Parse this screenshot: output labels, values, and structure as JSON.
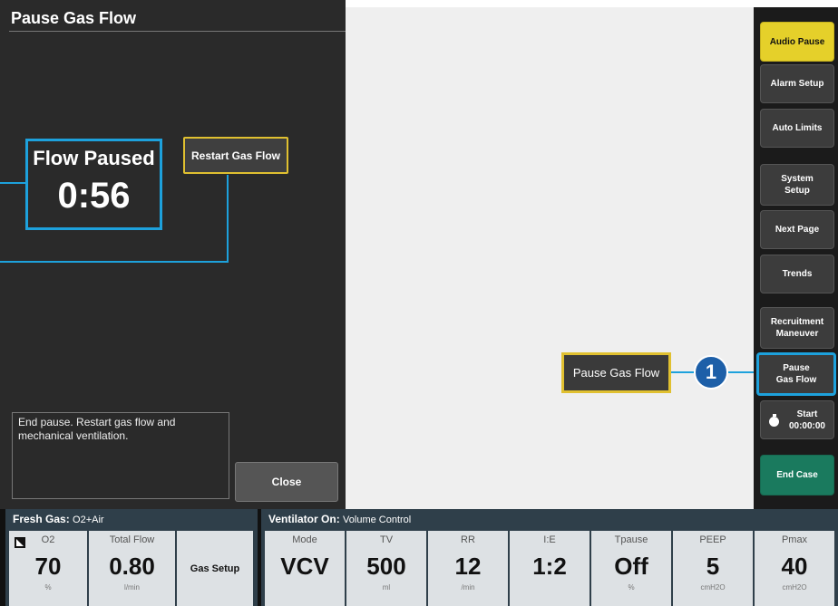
{
  "dialog": {
    "title": "Pause Gas Flow",
    "timer_label": "Flow Paused",
    "timer_value": "0:56",
    "restart_label": "Restart Gas Flow",
    "help_text": "End pause. Restart gas flow and mechanical ventilation.",
    "close_label": "Close"
  },
  "callout": {
    "tooltip": "Pause Gas Flow",
    "marker": "1"
  },
  "sidebar": {
    "audio_pause": "Audio Pause",
    "alarm_setup": "Alarm Setup",
    "auto_limits": "Auto Limits",
    "system_setup": "System Setup",
    "next_page": "Next Page",
    "trends": "Trends",
    "recruitment": "Recruitment Maneuver",
    "pause_gas_flow": "Pause Gas Flow",
    "timer_start": "Start",
    "timer_time": "00:00:00",
    "end_case": "End Case"
  },
  "fresh_gas": {
    "title": "Fresh Gas",
    "mix": "O2+Air",
    "o2": {
      "label": "O2",
      "value": "70",
      "unit": "%"
    },
    "total_flow": {
      "label": "Total Flow",
      "value": "0.80",
      "unit": "l/min"
    },
    "gas_setup": "Gas Setup"
  },
  "ventilator": {
    "title": "Ventilator On",
    "mode_name": "Volume Control",
    "params": [
      {
        "label": "Mode",
        "value": "VCV",
        "unit": ""
      },
      {
        "label": "TV",
        "value": "500",
        "unit": "ml"
      },
      {
        "label": "RR",
        "value": "12",
        "unit": "/min"
      },
      {
        "label": "I:E",
        "value": "1:2",
        "unit": ""
      },
      {
        "label": "Tpause",
        "value": "Off",
        "unit": "%"
      },
      {
        "label": "PEEP",
        "value": "5",
        "unit": "cmH2O"
      },
      {
        "label": "Pmax",
        "value": "40",
        "unit": "cmH2O"
      }
    ]
  },
  "colors": {
    "highlight": "#1da1dc",
    "focus": "#e0c030",
    "audio_pause": "#e5d02a",
    "end_case": "#1a7a5e"
  }
}
